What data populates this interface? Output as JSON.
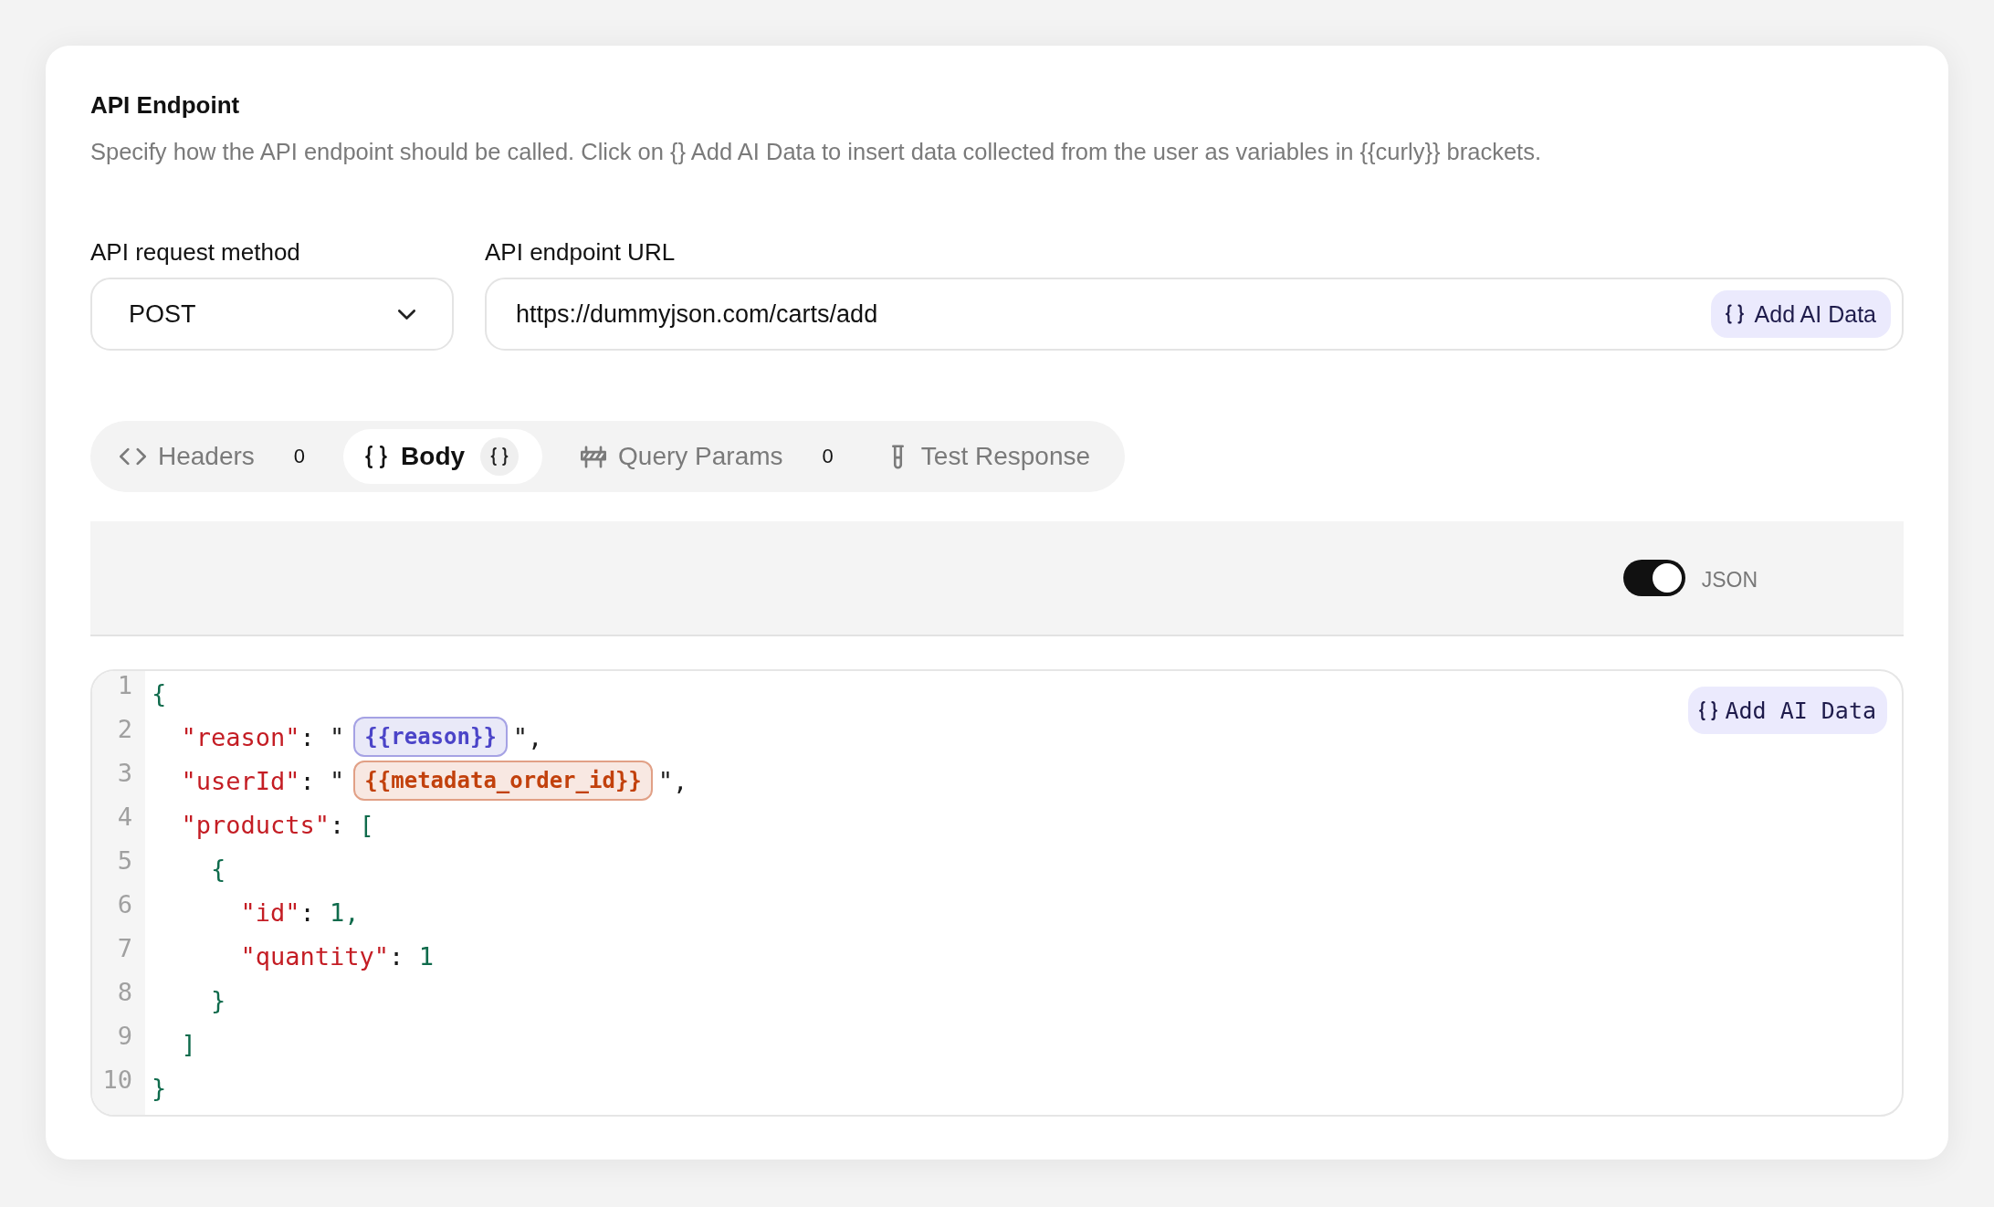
{
  "section": {
    "title": "API Endpoint",
    "description": "Specify how the API endpoint should be called. Click on {} Add AI Data to insert data collected from the user as variables in {{curly}} brackets."
  },
  "method_field": {
    "label": "API request method",
    "value": "POST"
  },
  "url_field": {
    "label": "API endpoint URL",
    "value": "https://dummyjson.com/carts/add",
    "action_button": "Add AI Data"
  },
  "tabs": [
    {
      "kind": "headers",
      "label": "Headers",
      "count": "0",
      "selected": false
    },
    {
      "kind": "body",
      "label": "Body",
      "selected": true
    },
    {
      "kind": "params",
      "label": "Query Params",
      "count": "0",
      "selected": false
    },
    {
      "kind": "test",
      "label": "Test Response",
      "selected": false
    }
  ],
  "body_toolbar": {
    "toggle": {
      "label": "JSON",
      "on": true
    }
  },
  "code_editor": {
    "action_button": "Add AI Data",
    "lines": [
      {
        "number": "1",
        "tokens": [
          {
            "kind": "bracket",
            "text": "{"
          }
        ]
      },
      {
        "number": "2",
        "tokens": [
          {
            "kind": "key",
            "text": "  \"reason\""
          },
          {
            "kind": "punctuation",
            "text": ": \""
          },
          {
            "kind": "variable",
            "text": "{{reason}}",
            "color": "#4b44c8"
          },
          {
            "kind": "punctuation",
            "text": "\","
          }
        ]
      },
      {
        "number": "3",
        "tokens": [
          {
            "kind": "key",
            "text": "  \"userId\""
          },
          {
            "kind": "punctuation",
            "text": ": \""
          },
          {
            "kind": "variable",
            "text": "{{metadata_order_id}}",
            "color": "#c2410c"
          },
          {
            "kind": "punctuation",
            "text": "\","
          }
        ]
      },
      {
        "number": "4",
        "tokens": [
          {
            "kind": "key",
            "text": "  \"products\""
          },
          {
            "kind": "punctuation",
            "text": ": "
          },
          {
            "kind": "bracket",
            "text": "["
          }
        ]
      },
      {
        "number": "5",
        "tokens": [
          {
            "kind": "bracket",
            "text": "    {"
          }
        ]
      },
      {
        "number": "6",
        "tokens": [
          {
            "kind": "key",
            "text": "      \"id\""
          },
          {
            "kind": "punctuation",
            "text": ": "
          },
          {
            "kind": "number",
            "text": "1,"
          }
        ]
      },
      {
        "number": "7",
        "tokens": [
          {
            "kind": "key",
            "text": "      \"quantity\""
          },
          {
            "kind": "punctuation",
            "text": ": "
          },
          {
            "kind": "number",
            "text": "1"
          }
        ]
      },
      {
        "number": "8",
        "tokens": [
          {
            "kind": "bracket",
            "text": "    }"
          }
        ]
      },
      {
        "number": "9",
        "tokens": [
          {
            "kind": "bracket",
            "text": "  ]"
          }
        ]
      },
      {
        "number": "10",
        "tokens": [
          {
            "kind": "bracket",
            "text": "}"
          }
        ]
      }
    ]
  }
}
